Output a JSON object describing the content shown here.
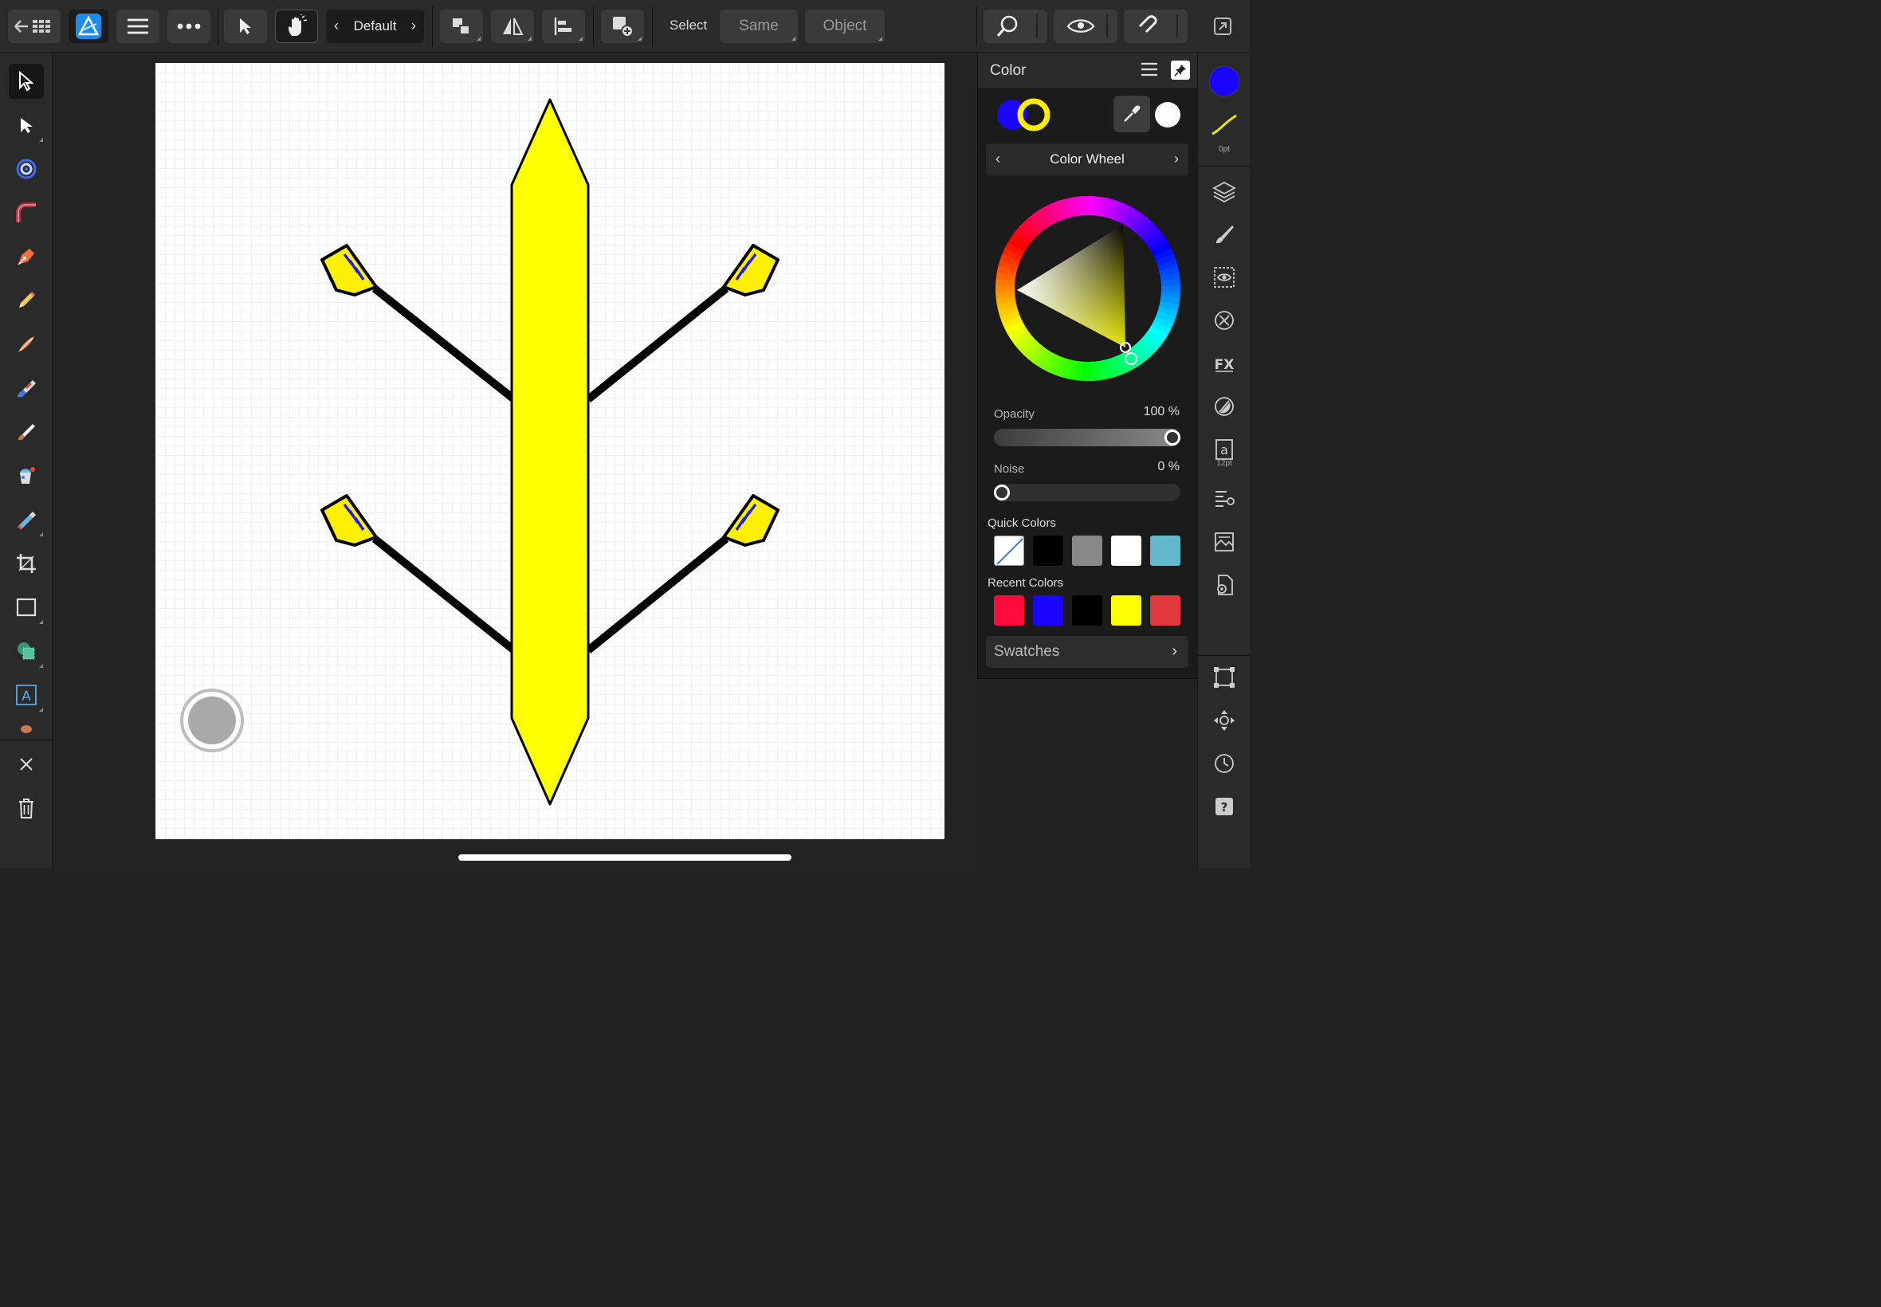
{
  "toolbar": {
    "persona_label": "Default",
    "select_label": "Select",
    "same_label": "Same",
    "object_label": "Object"
  },
  "color_panel": {
    "title": "Color",
    "mode": "Color Wheel",
    "fill_color": "#1a06ff",
    "stroke_color": "#ffee00",
    "opacity_label": "Opacity",
    "opacity_value": "100 %",
    "opacity": 1.0,
    "noise_label": "Noise",
    "noise_value": "0 %",
    "noise": 0.0,
    "quick_colors_label": "Quick Colors",
    "quick_colors": [
      "none",
      "#000000",
      "#888888",
      "#ffffff",
      "#62b7c9"
    ],
    "recent_colors_label": "Recent Colors",
    "recent_colors": [
      "#ff0a3a",
      "#1a06ff",
      "#000000",
      "#ffff00",
      "#e03a3a"
    ],
    "swatches_label": "Swatches"
  },
  "studio": {
    "stroke_width": "0pt",
    "text_size": "12pt"
  },
  "icons": {
    "left_tools": [
      "move-tool-icon",
      "node-tool-icon",
      "contour-tool-icon",
      "corner-tool-icon",
      "pen-tool-icon",
      "pencil-tool-icon",
      "vector-brush-icon",
      "fill-tool-icon",
      "paint-brush-icon",
      "color-picker-icon",
      "transparency-tool-icon",
      "crop-tool-icon",
      "rectangle-tool-icon",
      "shape-builder-icon",
      "artistic-text-icon"
    ],
    "right_studio": [
      "layers-icon",
      "brushes-icon",
      "appearance-icon",
      "stroke-icon",
      "effects-icon",
      "transparency-icon",
      "text-styles-icon",
      "paragraph-icon",
      "stock-icon",
      "document-settings-icon",
      "transform-icon",
      "navigator-icon",
      "history-icon",
      "help-icon"
    ]
  }
}
